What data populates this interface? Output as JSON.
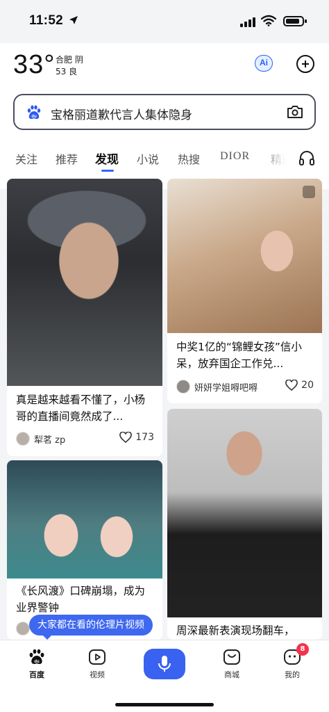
{
  "status": {
    "time": "11:52"
  },
  "header": {
    "temperature": "33°",
    "city": "合肥 阴",
    "aqi": "53 良",
    "ai_label": "Ai"
  },
  "search": {
    "placeholder": "宝格丽道歉代言人集体隐身"
  },
  "tabs": [
    "关注",
    "推荐",
    "发现",
    "小说",
    "热搜",
    "DIOR",
    "精选"
  ],
  "active_tab": "发现",
  "feed": [
    {
      "title": "真是越来越看不懂了，小杨哥的直播间竟然成了...",
      "author": "犁茗 zp",
      "likes": "173"
    },
    {
      "title": "中奖1亿的“锦鲤女孩”信小呆，放弃国企工作兑...",
      "author": "妍妍学姐嘚吧嘚",
      "likes": "20"
    },
    {
      "title": "《长风渡》口碑崩塌，成为业界警钟",
      "author": "",
      "likes": ""
    },
    {
      "title": "周深最新表演现场翻车，",
      "author": "",
      "likes": ""
    }
  ],
  "tooltip": "大家都在看的伦理片视频",
  "bottom_nav": {
    "home": "百度",
    "video": "视频",
    "mall": "商城",
    "me": "我的",
    "badge_count": "8"
  },
  "colors": {
    "accent": "#3a62f0",
    "badge": "#f4334d",
    "tab_underline": "#3366ff"
  }
}
